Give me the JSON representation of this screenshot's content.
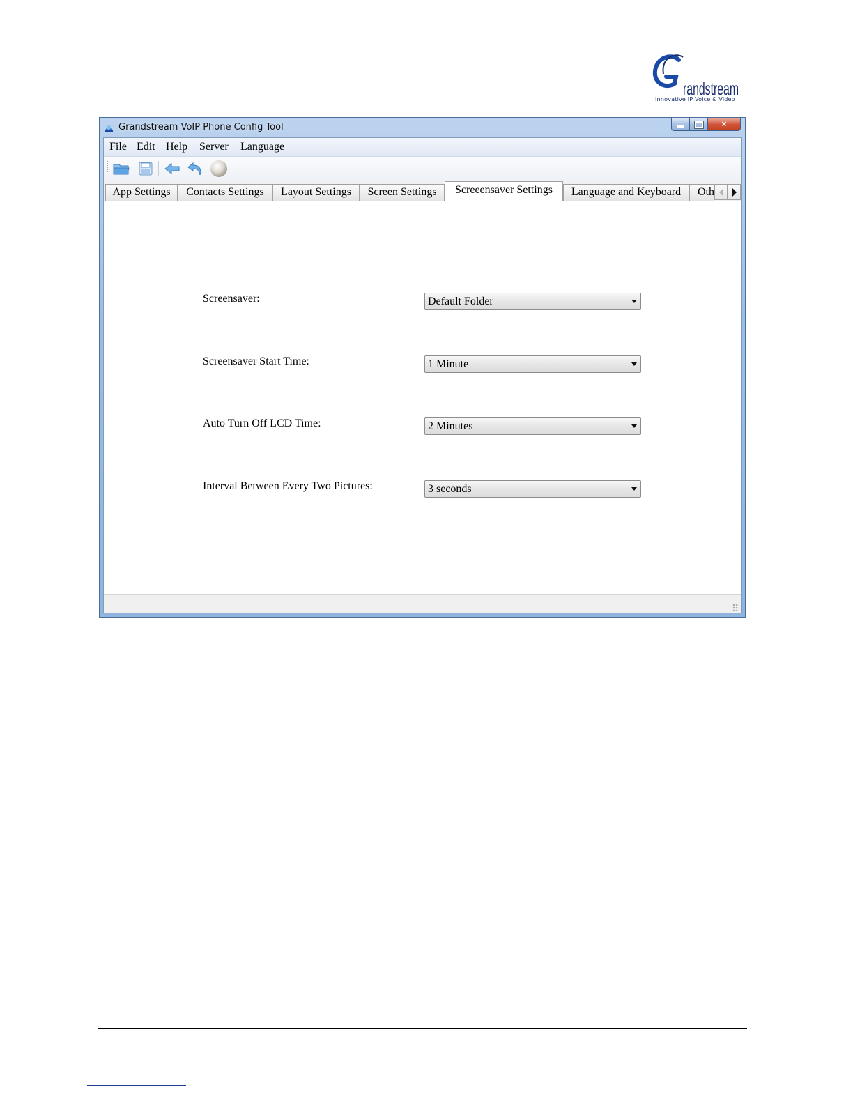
{
  "logo": {
    "brand_letter": "G",
    "brand_text": "randstream",
    "tagline": "Innovative IP Voice & Video",
    "colors": {
      "blue": "#1b4aa6",
      "navy": "#1b2f6b"
    }
  },
  "window": {
    "title": "Grandstream VoIP Phone Config Tool",
    "controls": {
      "minimize": "minimize-icon",
      "maximize": "maximize-icon",
      "close": "×"
    }
  },
  "menu": {
    "file": "File",
    "edit": "Edit",
    "help": "Help",
    "server": "Server",
    "language": "Language"
  },
  "toolbar": {
    "icons": [
      "open-folder-icon",
      "save-icon",
      "back-arrow-icon",
      "undo-icon",
      "status-ball-icon"
    ]
  },
  "tabs": {
    "app": "App Settings",
    "contacts": "Contacts Settings",
    "layout": "Layout Settings",
    "screen": "Screen Settings",
    "screensaver": "Screeensaver Settings",
    "language": "Language and Keyboard",
    "other": "Oth",
    "active": "Screeensaver Settings"
  },
  "form": {
    "screensaver": {
      "label": "Screensaver:",
      "value": "Default Folder"
    },
    "start_time": {
      "label": "Screensaver Start Time:",
      "value": "1 Minute"
    },
    "lcd_off": {
      "label": "Auto Turn Off LCD Time:",
      "value": "2 Minutes"
    },
    "interval": {
      "label": "Interval Between Every Two Pictures:",
      "value": "3 seconds"
    }
  }
}
